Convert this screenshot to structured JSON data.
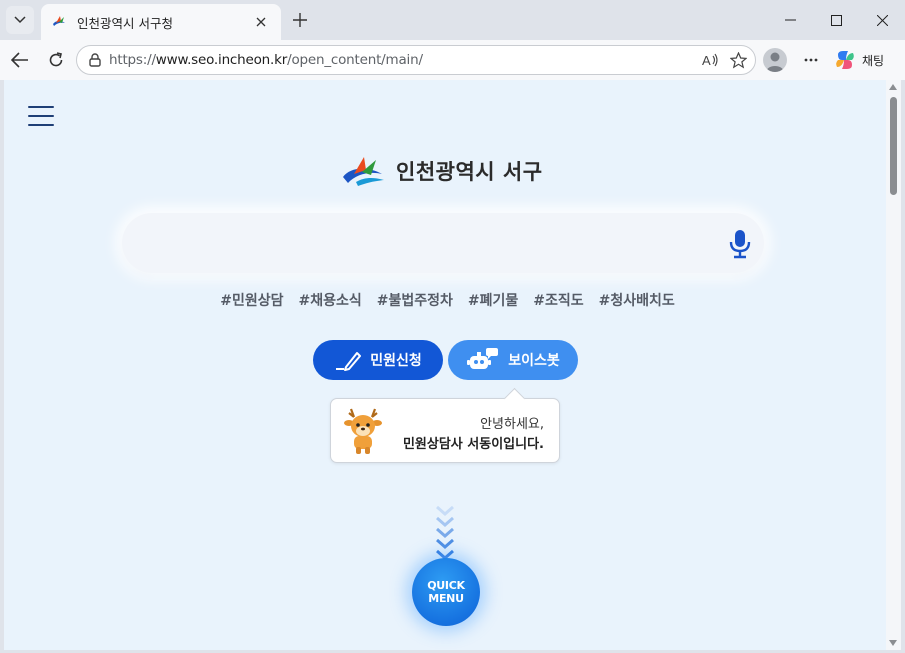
{
  "browser": {
    "tab_title": "인천광역시 서구청",
    "url_prefix": "https://",
    "url_host": "www.seo.incheon.kr",
    "url_path": "/open_content/main/",
    "chat_label": "채팅"
  },
  "page": {
    "logo_text": "인천광역시 서구",
    "search_placeholder": "",
    "tags": [
      "#민원상담",
      "#채용소식",
      "#불법주정차",
      "#폐기물",
      "#조직도",
      "#청사배치도"
    ],
    "buttons": {
      "civil_request": "민원신청",
      "voice_bot": "보이스봇"
    },
    "bubble": {
      "greeting": "안녕하세요,",
      "intro": "민원상담사 서동이입니다."
    },
    "quick_menu": {
      "line1": "QUICK",
      "line2": "MENU"
    },
    "colors": {
      "page_background": "#e9f3fc",
      "primary_blue": "#1257d6",
      "light_blue": "#3f8ff0"
    }
  }
}
